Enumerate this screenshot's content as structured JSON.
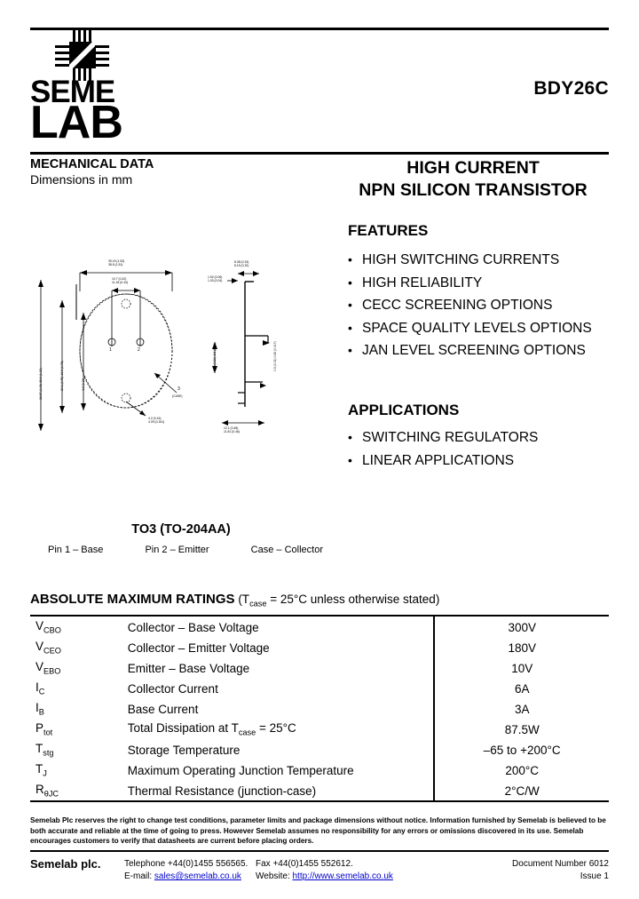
{
  "header": {
    "logo_top": "SEME",
    "logo_bottom": "LAB",
    "logo_icon": "semelab-grid-logo",
    "part_number": "BDY26C",
    "mechanical_title": "MECHANICAL DATA",
    "mechanical_sub": "Dimensions in mm",
    "product_title_line1": "HIGH CURRENT",
    "product_title_line2": "NPN SILICON TRANSISTOR"
  },
  "features": {
    "heading": "FEATURES",
    "items": [
      "HIGH SWITCHING CURRENTS",
      "HIGH RELIABILITY",
      "CECC SCREENING OPTIONS",
      "SPACE QUALITY LEVELS OPTIONS",
      "JAN LEVEL SCREENING OPTIONS"
    ]
  },
  "applications": {
    "heading": "APPLICATIONS",
    "items": [
      "SWITCHING REGULATORS",
      "LINEAR APPLICATIONS"
    ]
  },
  "package": {
    "name": "TO3 (TO-204AA)",
    "pins": [
      "Pin 1 – Base",
      "Pin 2 – Emitter",
      "Case – Collector"
    ],
    "drawing_labels": {
      "top_width": "39.15 (1.53)",
      "top_width2": "38.5 (1.51)",
      "pin_span": "10.7 (0.42)",
      "pin_span2": "11.18 (0.44)",
      "pin_1": "1",
      "pin_2": "2",
      "case_pin": "3",
      "case_note": "(CASE)",
      "hole_dia": "4.2 (0.16)",
      "hole_dia2": "4.09 (0.161)",
      "left_dim": "26.67 (1.05)",
      "left_dim2": "25.9 (1.02)",
      "left_dim3": "20.1 (0.79)",
      "left_dim4": "19.9 (0.78)",
      "side_top": "8.38 (0.33)",
      "side_top2": "8.15 (0.32)",
      "side_h": "1.52 (0.06)",
      "side_h2": "1.03 (0.04)",
      "side_lead": "0.5 (0.02)",
      "side_lead2": "0.43 (0.017)",
      "side_base": "12.1 (0.48)",
      "side_base2": "11.81 (0.46)",
      "side_left": "5.08 (0.20)",
      "side_left2": "4.6 (0.18)"
    }
  },
  "ratings": {
    "heading": "ABSOLUTE MAXIMUM RATINGS",
    "condition_pre": "(T",
    "condition_sub": "case",
    "condition_post": " = 25°C unless otherwise stated)",
    "rows": [
      {
        "symbol_main": "V",
        "symbol_sub": "CBO",
        "description": "Collector – Base Voltage",
        "value": "300V"
      },
      {
        "symbol_main": "V",
        "symbol_sub": "CEO",
        "description": "Collector – Emitter Voltage",
        "value": "180V"
      },
      {
        "symbol_main": "V",
        "symbol_sub": "EBO",
        "description": "Emitter – Base Voltage",
        "value": "10V"
      },
      {
        "symbol_main": "I",
        "symbol_sub": "C",
        "description": "Collector Current",
        "value": "6A"
      },
      {
        "symbol_main": "I",
        "symbol_sub": "B",
        "description": "Base Current",
        "value": "3A"
      },
      {
        "symbol_main": "P",
        "symbol_sub": "tot",
        "description": "Total Dissipation at T",
        "desc_sub": "case",
        "desc_post": " = 25°C",
        "value": "87.5W"
      },
      {
        "symbol_main": "T",
        "symbol_sub": "stg",
        "description": "Storage Temperature",
        "value": "–65 to +200°C"
      },
      {
        "symbol_main": "T",
        "symbol_sub": "J",
        "description": "Maximum Operating Junction Temperature",
        "value": "200°C"
      },
      {
        "symbol_main": "R",
        "symbol_sub": "θJC",
        "description": "Thermal Resistance (junction-case)",
        "value": "2°C/W"
      }
    ]
  },
  "footer": {
    "disclaimer": "Semelab Plc reserves the right to change test conditions, parameter limits and package dimensions without notice. Information furnished by Semelab is believed to be both accurate and reliable at the time of going to press. However Semelab assumes no responsibility for any errors or omissions discovered in its use. Semelab encourages customers to verify that datasheets are current before placing orders.",
    "company": "Semelab plc.",
    "telephone": "Telephone +44(0)1455 556565.",
    "fax": "Fax +44(0)1455 552612.",
    "email_label": "E-mail: ",
    "email": "sales@semelab.co.uk",
    "website_label": "Website: ",
    "website": "http://www.semelab.co.uk",
    "document_number": "Document Number 6012",
    "issue": "Issue 1"
  }
}
